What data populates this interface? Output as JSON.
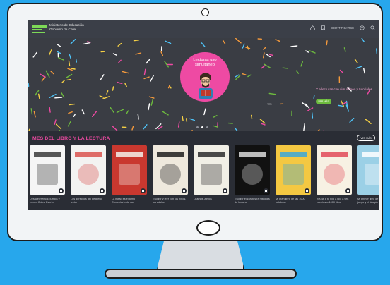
{
  "header": {
    "ministry_line1": "Ministerio de Educación",
    "ministry_line2": "Gobierno de Chile",
    "nav_label": "IDENTIFICARSE",
    "icons": [
      "home-icon",
      "bookmark-icon",
      "user-icon",
      "search-icon"
    ]
  },
  "hero": {
    "circle_title_1": "Lecturas uso",
    "circle_title_2": "simultáneo",
    "side_text": "Y a lecturas con simultáneo y tutoriales",
    "button_label": "VER MÁS",
    "active_slide": 1,
    "slide_count": 3
  },
  "section": {
    "title": "MES DEL LIBRO Y LA LECTURA",
    "see_all_label": "VER MÁS"
  },
  "books": [
    {
      "title": "Desaceleremos: juegos y crecer Cobre Escrito",
      "cover": "#f5f5f5",
      "accent": "#3a3a3a"
    },
    {
      "title": "Los derechos del pequeño lector",
      "cover": "#f3f3f1",
      "accent": "#d9534f"
    },
    {
      "title": "La mitad es el tomo Comentario de sus",
      "cover": "#c9382f",
      "accent": "#f4f0ea"
    },
    {
      "title": "Escribir y leer con los niños, los adultos",
      "cover": "#efe9dd",
      "accent": "#1e1e1e"
    },
    {
      "title": "Leamos Juntos",
      "cover": "#f1efe6",
      "accent": "#2c2c2c"
    },
    {
      "title": "Escribir el zaratustra historias de lectura",
      "cover": "#111111",
      "accent": "#dcdcdc"
    },
    {
      "title": "Mi gran libro de las 1000 palabras",
      "cover": "#f4c842",
      "accent": "#3aa7d8"
    },
    {
      "title": "Ayuda a tu hijo a hijo a ser, cuentos a 1000 libro",
      "cover": "#f7f1e3",
      "accent": "#e24a58"
    },
    {
      "title": "Mi primer libro de la mejor juego y el dragón",
      "cover": "#9bd0e6",
      "accent": "#ffffff"
    }
  ],
  "colors": {
    "background": "#27a7ec",
    "accent_pink": "#ee4aa3",
    "accent_green": "#6dbb3e"
  }
}
